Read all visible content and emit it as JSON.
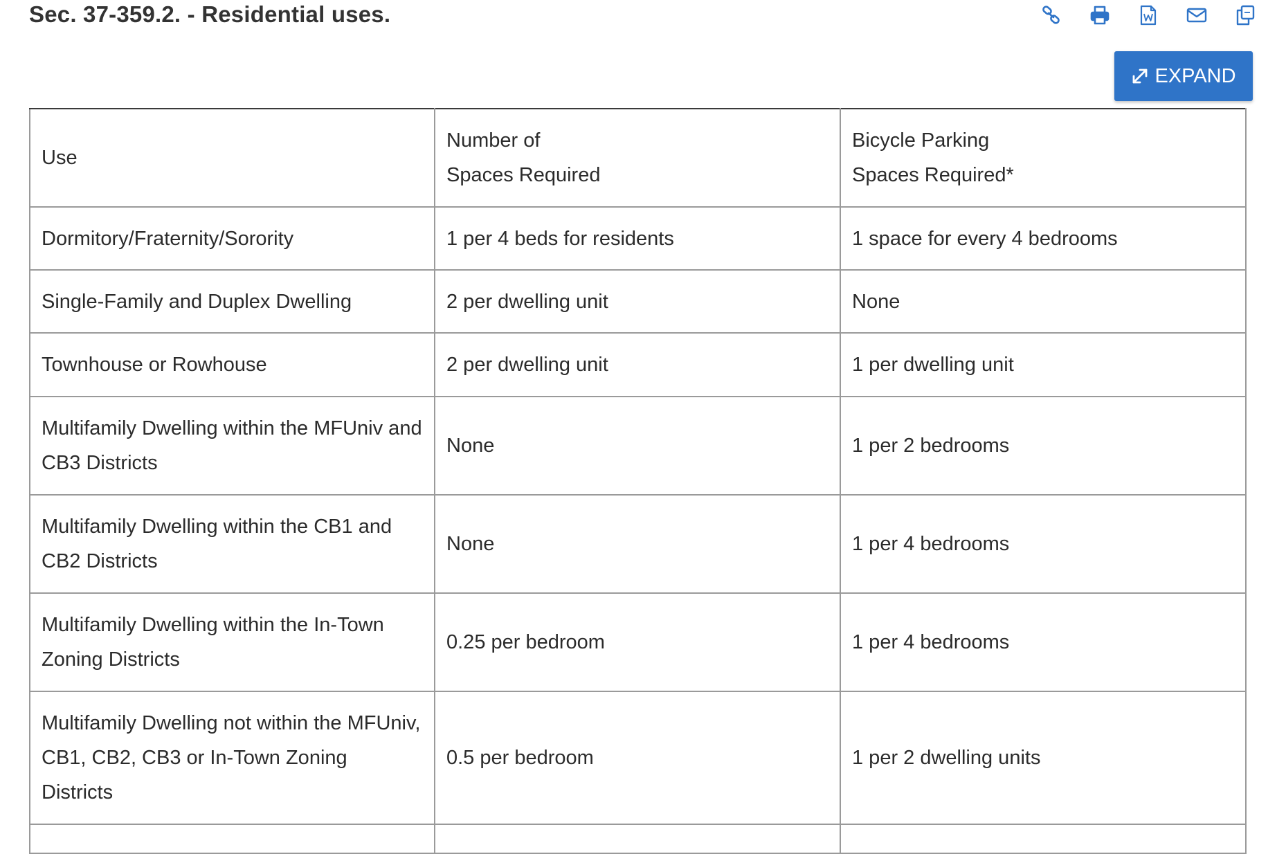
{
  "header": {
    "title": "Sec. 37-359.2. - Residential uses."
  },
  "toolbar": {
    "icons": [
      "link-icon",
      "print-icon",
      "word-doc-icon",
      "email-icon",
      "copy-icon"
    ],
    "accent_color": "#2f74c8"
  },
  "expand_button": {
    "label": "EXPAND",
    "color": "#2f74c8"
  },
  "table": {
    "headers": {
      "use": "Use",
      "spaces_line1": "Number of",
      "spaces_line2": "Spaces Required",
      "bike_line1": "Bicycle Parking",
      "bike_line2": "Spaces Required*"
    },
    "rows": [
      {
        "use": "Dormitory/Fraternity/Sorority",
        "spaces": "1 per 4 beds for residents",
        "bicycle": "1 space for every 4 bedrooms"
      },
      {
        "use": "Single-Family and Duplex Dwelling",
        "spaces": "2 per dwelling unit",
        "bicycle": "None"
      },
      {
        "use": "Townhouse or Rowhouse",
        "spaces": "2 per dwelling unit",
        "bicycle": "1 per dwelling unit"
      },
      {
        "use": "Multifamily Dwelling within the MFUniv and CB3 Districts",
        "spaces": "None",
        "bicycle": "1 per 2 bedrooms"
      },
      {
        "use": "Multifamily Dwelling within the CB1 and CB2 Districts",
        "spaces": "None",
        "bicycle": "1 per 4 bedrooms"
      },
      {
        "use": "Multifamily Dwelling within the In-Town Zoning Districts",
        "spaces": "0.25 per bedroom",
        "bicycle": "1 per 4 bedrooms"
      },
      {
        "use": "Multifamily Dwelling not within the MFUniv, CB1, CB2, CB3 or In-Town Zoning Districts",
        "spaces": "0.5 per bedroom",
        "bicycle": "1 per 2 dwelling units"
      }
    ]
  }
}
